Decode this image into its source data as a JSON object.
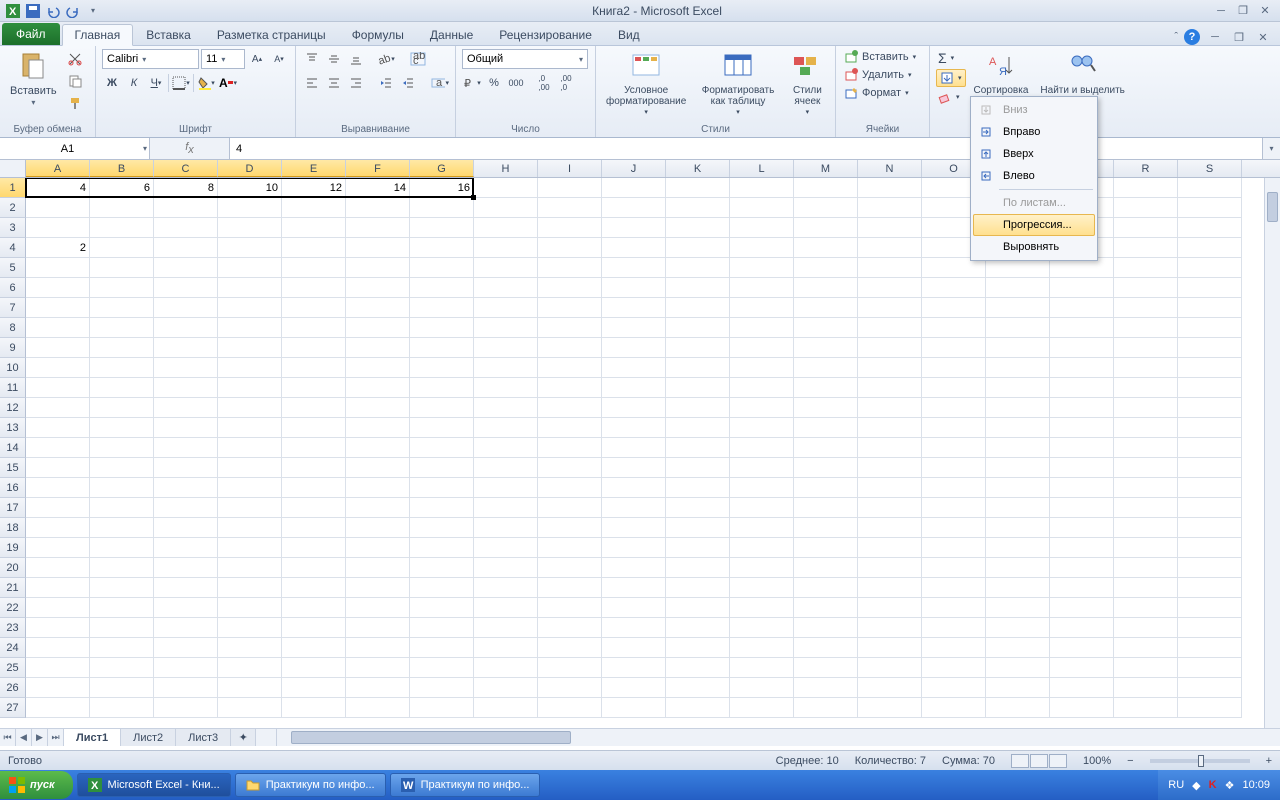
{
  "title": "Книга2 - Microsoft Excel",
  "qat": {
    "items": [
      "excel",
      "save",
      "undo",
      "redo"
    ]
  },
  "tabs": {
    "file": "Файл",
    "list": [
      "Главная",
      "Вставка",
      "Разметка страницы",
      "Формулы",
      "Данные",
      "Рецензирование",
      "Вид"
    ],
    "active": 0
  },
  "ribbon": {
    "groups": {
      "clipboard": {
        "label": "Буфер обмена",
        "paste": "Вставить"
      },
      "font": {
        "label": "Шрифт",
        "name": "Calibri",
        "size": "11",
        "bold": "Ж",
        "italic": "К",
        "underline": "Ч"
      },
      "alignment": {
        "label": "Выравнивание"
      },
      "number": {
        "label": "Число",
        "format": "Общий"
      },
      "styles": {
        "label": "Стили",
        "cond": "Условное форматирование",
        "table": "Форматировать как таблицу",
        "cell": "Стили ячеек"
      },
      "cells": {
        "label": "Ячейки",
        "insert": "Вставить",
        "delete": "Удалить",
        "format": "Формат"
      },
      "editing": {
        "label": "",
        "sort": "Сортировка",
        "find": "Найти и выделить"
      }
    }
  },
  "namebox": "A1",
  "formula_value": "4",
  "columns": [
    "A",
    "B",
    "C",
    "D",
    "E",
    "F",
    "G",
    "H",
    "I",
    "J",
    "K",
    "L",
    "M",
    "N",
    "O",
    "P",
    "Q",
    "R",
    "S"
  ],
  "rows_visible": 27,
  "cells": {
    "r1": {
      "A": "4",
      "B": "6",
      "C": "8",
      "D": "10",
      "E": "12",
      "F": "14",
      "G": "16"
    },
    "r4": {
      "A": "2"
    }
  },
  "selection": {
    "row": 1,
    "col_start": 0,
    "col_end": 6
  },
  "sheet_tabs": {
    "list": [
      "Лист1",
      "Лист2",
      "Лист3"
    ],
    "active": 0
  },
  "status": {
    "ready": "Готово",
    "avg_label": "Среднее:",
    "avg": "10",
    "count_label": "Количество:",
    "count": "7",
    "sum_label": "Сумма:",
    "sum": "70",
    "zoom": "100%"
  },
  "fill_menu": {
    "down": "Вниз",
    "right": "Вправо",
    "up": "Вверх",
    "left": "Влево",
    "sheets": "По листам...",
    "series": "Прогрессия...",
    "justify": "Выровнять"
  },
  "taskbar": {
    "start": "пуск",
    "items": [
      "Microsoft Excel - Кни...",
      "Практикум по инфо...",
      "Практикум по инфо..."
    ],
    "lang": "RU",
    "time": "10:09"
  }
}
